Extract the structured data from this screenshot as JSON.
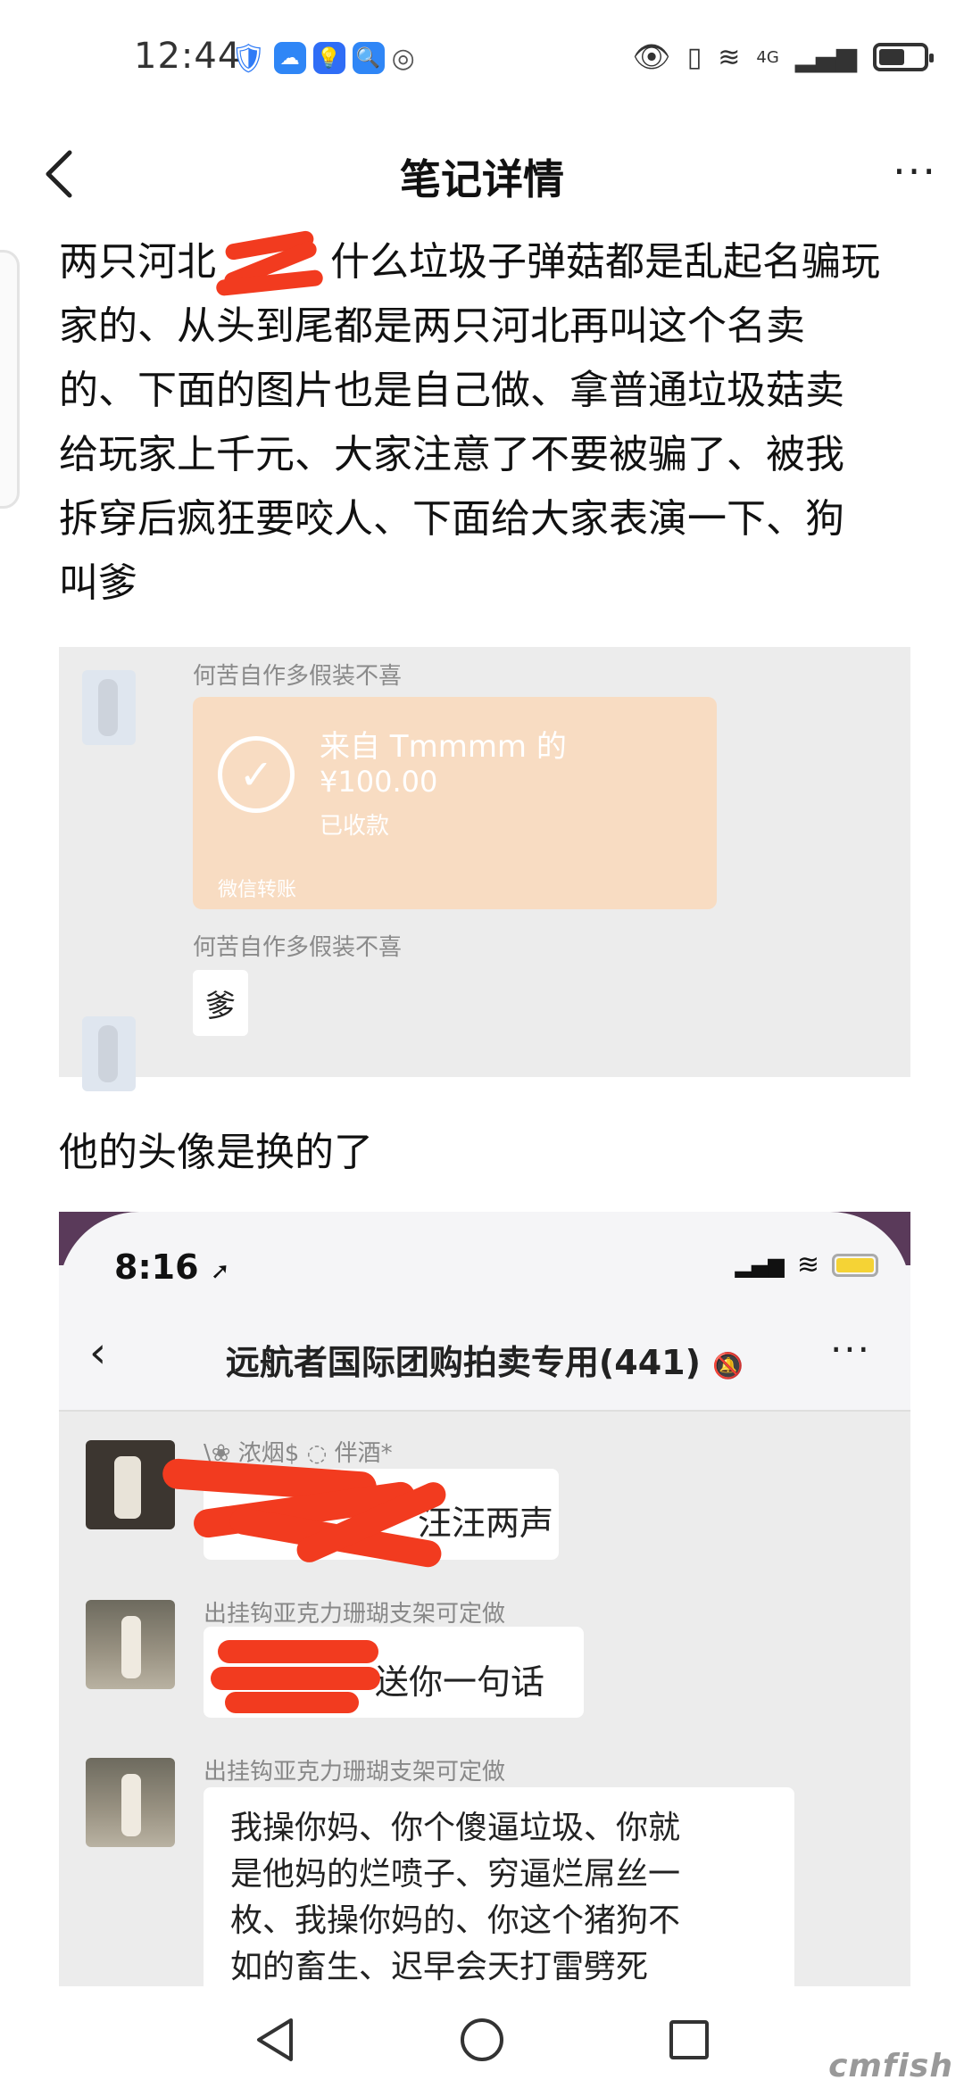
{
  "status_bar": {
    "time": "12:44",
    "network": "4G"
  },
  "nav": {
    "title": "笔记详情",
    "back_icon": "chevron-left-icon",
    "more_label": "···"
  },
  "post": {
    "text_lines": [
      "两只河北",
      "什么垃圾子弹菇都是乱起名骗玩",
      "家的、从头到尾都是两只河北再叫这个名卖",
      "的、下面的图片也是自己做、拿普通垃圾菇卖",
      "给玩家上千元、大家注意了不要被骗了、被我",
      "拆穿后疯狂要咬人、下面给大家表演一下、狗",
      "叫爹"
    ],
    "caption": "他的头像是换的了"
  },
  "screenshot1": {
    "sender_name_1": "何苦自作多假装不喜",
    "transfer_from": "来自 Tmmmm 的",
    "transfer_amount": "¥100.00",
    "transfer_status": "已收款",
    "transfer_footer": "微信转账",
    "sender_name_2": "何苦自作多假装不喜",
    "message_2": "爹"
  },
  "screenshot2": {
    "time": "8:16",
    "group_title": "远航者国际团购拍卖专用(441)",
    "more_label": "···",
    "msg1_name": "\\❀ 浓烟$ ◌ 伴酒*",
    "msg1_text": "汪汪两声",
    "msg2_name": "出挂钩亚克力珊瑚支架可定做",
    "msg2_text": "送你一句话",
    "msg3_name": "出挂钩亚克力珊瑚支架可定做",
    "msg3_lines": [
      "我操你妈、你个傻逼垃圾、你就",
      "是他妈的烂喷子、穷逼烂屌丝一",
      "枚、我操你妈的、你这个猪狗不",
      "如的畜生、迟早会天打雷劈死"
    ]
  },
  "watermark": "cmfish",
  "colors": {
    "redaction": "#f23b1f",
    "transfer_card": "#f8dcc2",
    "background": "#ffffff"
  }
}
